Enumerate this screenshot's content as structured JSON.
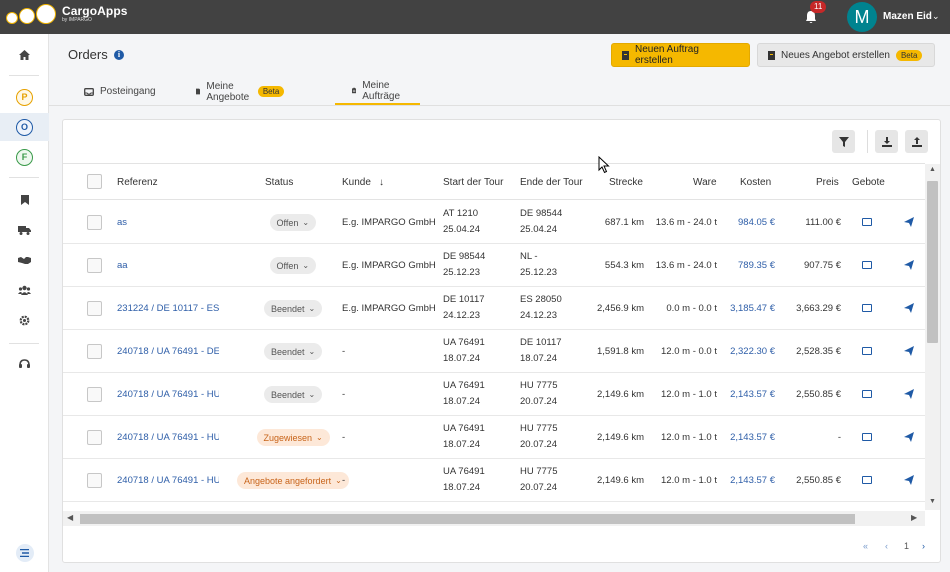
{
  "app": {
    "title": "CargoApps",
    "subtitle": "by IMPARGO"
  },
  "topbar": {
    "notifications": "11",
    "avatar_initial": "M",
    "user_name": "Mazen Eid"
  },
  "sidebar": {
    "items": [
      {
        "icon": "home-icon"
      },
      {
        "letter": "P",
        "color": "#e6a100"
      },
      {
        "letter": "O",
        "color": "#1f5aa6",
        "active": true
      },
      {
        "letter": "F",
        "color": "#3a9a4a"
      },
      {
        "icon": "bookmark-icon"
      },
      {
        "icon": "truck-icon"
      },
      {
        "icon": "handshake-icon"
      },
      {
        "icon": "users-icon"
      },
      {
        "icon": "gear-icon"
      },
      {
        "icon": "headset-icon"
      },
      {
        "icon": "list-icon"
      }
    ]
  },
  "page": {
    "title": "Orders"
  },
  "buttons": {
    "new_order": "Neuen Auftrag erstellen",
    "new_offer": "Neues Angebot erstellen",
    "beta": "Beta"
  },
  "tabs": [
    {
      "label": "Posteingang",
      "icon": "inbox-icon"
    },
    {
      "label": "Meine Angebote",
      "icon": "document-icon",
      "badge": "Beta"
    },
    {
      "label": "Meine Aufträge",
      "icon": "clipboard-icon",
      "active": true
    }
  ],
  "table": {
    "headers": {
      "referenz": "Referenz",
      "status": "Status",
      "kunde": "Kunde",
      "start": "Start der Tour",
      "ende": "Ende der Tour",
      "strecke": "Strecke",
      "ware": "Ware",
      "kosten": "Kosten",
      "preis": "Preis",
      "gebote": "Gebote"
    },
    "rows": [
      {
        "ref": "as",
        "status": "Offen",
        "kunde": "E.g. IMPARGO GmbH",
        "start1": "AT 1210",
        "start2": "25.04.24",
        "ende1": "DE 98544",
        "ende2": "25.04.24",
        "strecke": "687.1 km",
        "ware": "13.6 m - 24.0 t",
        "kosten": "984.05 €",
        "preis": "111.00 €"
      },
      {
        "ref": "aa",
        "status": "Offen",
        "kunde": "E.g. IMPARGO GmbH",
        "start1": "DE 98544",
        "start2": "25.12.23",
        "ende1": "NL -",
        "ende2": "25.12.23",
        "strecke": "554.3 km",
        "ware": "13.6 m - 24.0 t",
        "kosten": "789.35 €",
        "preis": "907.75 €"
      },
      {
        "ref": "231224 / DE 10117 - ES",
        "status": "Beendet",
        "kunde": "E.g. IMPARGO GmbH",
        "start1": "DE 10117",
        "start2": "24.12.23",
        "ende1": "ES 28050",
        "ende2": "24.12.23",
        "strecke": "2,456.9 km",
        "ware": "0.0 m - 0.0 t",
        "kosten": "3,185.47 €",
        "preis": "3,663.29 €"
      },
      {
        "ref": "240718 / UA 76491 - DE",
        "status": "Beendet",
        "kunde": "-",
        "start1": "UA 76491",
        "start2": "18.07.24",
        "ende1": "DE 10117",
        "ende2": "18.07.24",
        "strecke": "1,591.8 km",
        "ware": "12.0 m - 0.0 t",
        "kosten": "2,322.30 €",
        "preis": "2,528.35 €"
      },
      {
        "ref": "240718 / UA 76491 - HU",
        "status": "Beendet",
        "kunde": "-",
        "start1": "UA 76491",
        "start2": "18.07.24",
        "ende1": "HU 7775",
        "ende2": "20.07.24",
        "strecke": "2,149.6 km",
        "ware": "12.0 m - 1.0 t",
        "kosten": "2,143.57 €",
        "preis": "2,550.85 €"
      },
      {
        "ref": "240718 / UA 76491 - HU",
        "status": "Zugewiesen",
        "kunde": "-",
        "start1": "UA 76491",
        "start2": "18.07.24",
        "ende1": "HU 7775",
        "ende2": "20.07.24",
        "strecke": "2,149.6 km",
        "ware": "12.0 m - 1.0 t",
        "kosten": "2,143.57 €",
        "preis": "-"
      },
      {
        "ref": "240718 / UA 76491 - HU",
        "status": "Angebote angefordert",
        "kunde": "-",
        "start1": "UA 76491",
        "start2": "18.07.24",
        "ende1": "HU 7775",
        "ende2": "20.07.24",
        "strecke": "2,149.6 km",
        "ware": "12.0 m - 1.0 t",
        "kosten": "2,143.57 €",
        "preis": "2,550.85 €"
      }
    ]
  },
  "pagination": {
    "first": "«",
    "prev": "‹",
    "page": "1",
    "next": "›"
  }
}
